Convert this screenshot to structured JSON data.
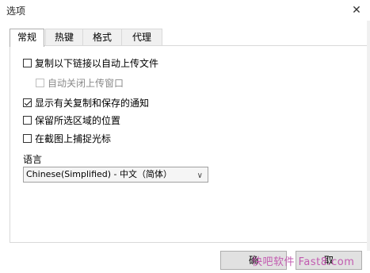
{
  "window": {
    "title": "选项",
    "close_glyph": "✕"
  },
  "tabs": [
    {
      "label": "常规",
      "active": true
    },
    {
      "label": "热键",
      "active": false
    },
    {
      "label": "格式",
      "active": false
    },
    {
      "label": "代理",
      "active": false
    }
  ],
  "options": [
    {
      "label": "复制以下链接以自动上传文件",
      "checked": false,
      "disabled": false
    },
    {
      "label": "自动关闭上传窗口",
      "checked": false,
      "disabled": true
    },
    {
      "label": "显示有关复制和保存的通知",
      "checked": true,
      "disabled": false
    },
    {
      "label": "保留所选区域的位置",
      "checked": false,
      "disabled": false
    },
    {
      "label": "在截图上捕捉光标",
      "checked": false,
      "disabled": false
    }
  ],
  "language": {
    "label": "语言",
    "selected": "Chinese(Simplified) - 中文（简体）"
  },
  "buttons": {
    "ok_label": "确",
    "cancel_label": "取"
  },
  "watermark": "快吧软件 Fast8.com"
}
